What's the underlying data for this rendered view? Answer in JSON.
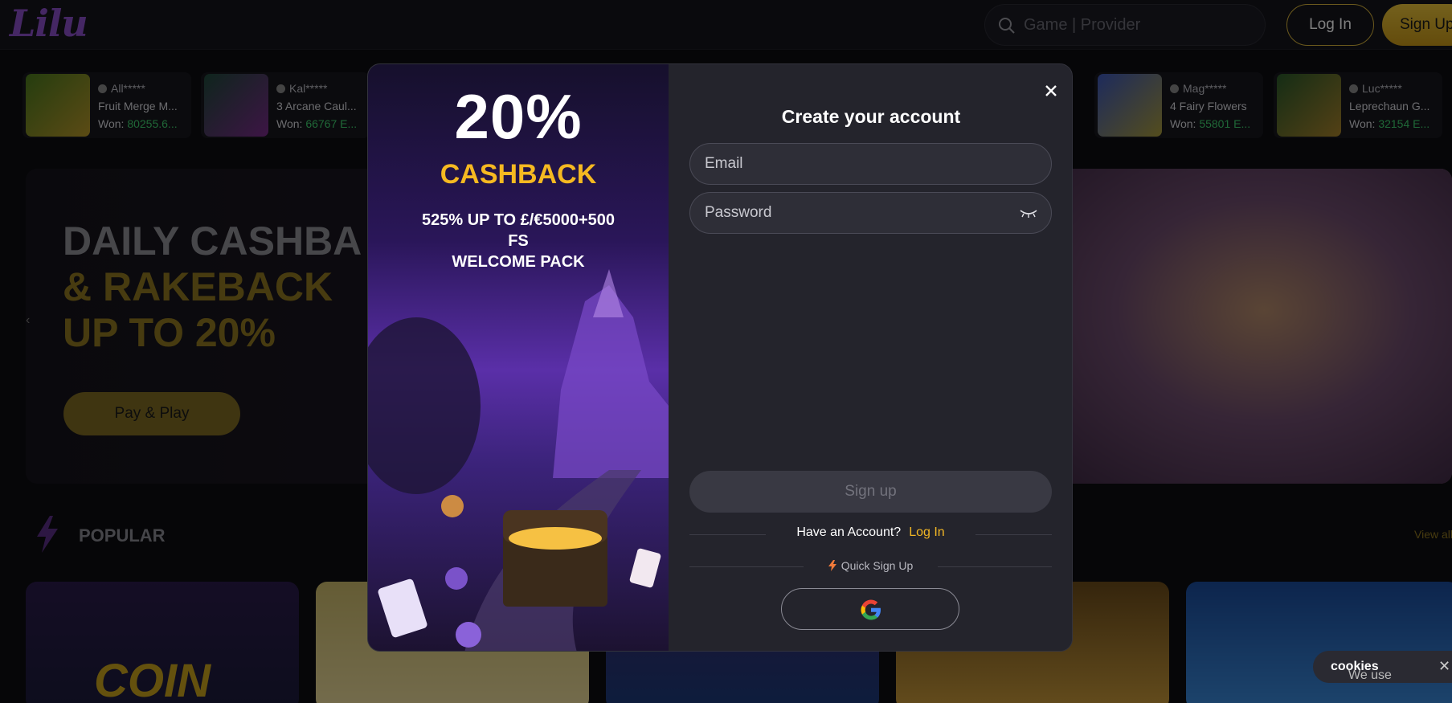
{
  "header": {
    "logo": "Lilu",
    "search_placeholder": "Game | Provider",
    "login_label": "Log In",
    "signup_label": "Sign Up"
  },
  "ticker": [
    {
      "user": "All*****",
      "game": "Fruit Merge M...",
      "won_label": "Won:",
      "amount": "80255.6...",
      "color": "#6a8a2a"
    },
    {
      "user": "Kal*****",
      "game": "3 Arcane Caul...",
      "won_label": "Won:",
      "amount": "66767 E...",
      "color": "#2d6a4a"
    },
    {
      "user": "Mag*****",
      "game": "4 Fairy Flowers",
      "won_label": "Won:",
      "amount": "55801 E...",
      "color": "#3b56b8"
    },
    {
      "user": "Luc*****",
      "game": "Leprechaun G...",
      "won_label": "Won:",
      "amount": "32154 E...",
      "color": "#8a6a22"
    }
  ],
  "hero": {
    "line1": "DAILY CASHBA",
    "line2": "& RAKEBACK",
    "line3": "UP TO 20%",
    "button": "Pay & Play",
    "arrow": "‹"
  },
  "popular": {
    "title": "POPULAR",
    "view_all": "View all"
  },
  "cards": {
    "coin_text": "COIN"
  },
  "modal": {
    "promo": {
      "percent": "20%",
      "cashback": "CASHBACK",
      "offer_line1": "525% UP TO £/€5000+500",
      "offer_line2": "FS",
      "offer_line3": "WELCOME PACK"
    },
    "title": "Create your account",
    "email_placeholder": "Email",
    "password_placeholder": "Password",
    "signup_button": "Sign up",
    "have_account": "Have an Account?",
    "login_link": "Log In",
    "quick_signup": "Quick Sign Up"
  },
  "cookies": {
    "prefix": "We use ",
    "bold": "cookies",
    "close": "✕"
  }
}
